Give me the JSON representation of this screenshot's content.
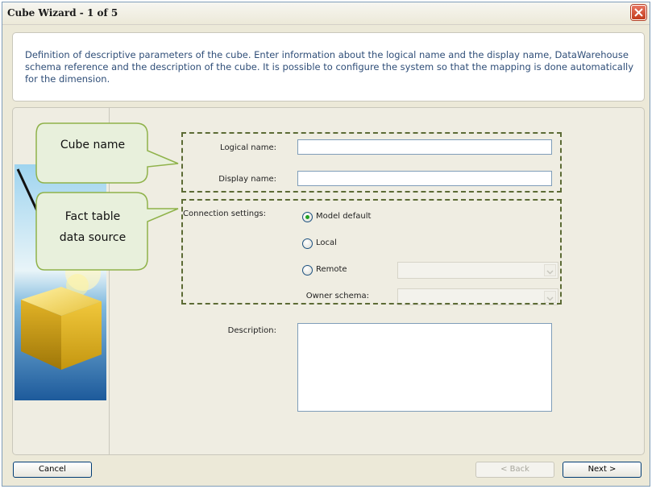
{
  "window": {
    "title": "Cube Wizard - 1 of 5"
  },
  "description_panel": {
    "text": "Definition of descriptive parameters of the cube. Enter information about the logical name and the display name, DataWarehouse schema reference and the description of the cube. It is possible to configure the system so that the mapping is done automatically for the dimension."
  },
  "form": {
    "logical_name_label": "Logical name:",
    "logical_name_value": "",
    "display_name_label": "Display name:",
    "display_name_value": "",
    "connection_settings_label": "Connection settings:",
    "radio_model_default": "Model default",
    "radio_local": "Local",
    "radio_remote": "Remote",
    "selected_connection": "Model default",
    "owner_schema_label": "Owner schema:",
    "description_label": "Description:",
    "description_value": ""
  },
  "callouts": {
    "cube_name": "Cube name",
    "fact_table_line1": "Fact table",
    "fact_table_line2": "data source"
  },
  "buttons": {
    "cancel": "Cancel",
    "back": "< Back",
    "next": "Next >"
  },
  "colors": {
    "description_text": "#2f4e78",
    "callout_fill": "#e8f0dc",
    "callout_border": "#8fb24a",
    "dashed_border": "#5c6b35"
  }
}
